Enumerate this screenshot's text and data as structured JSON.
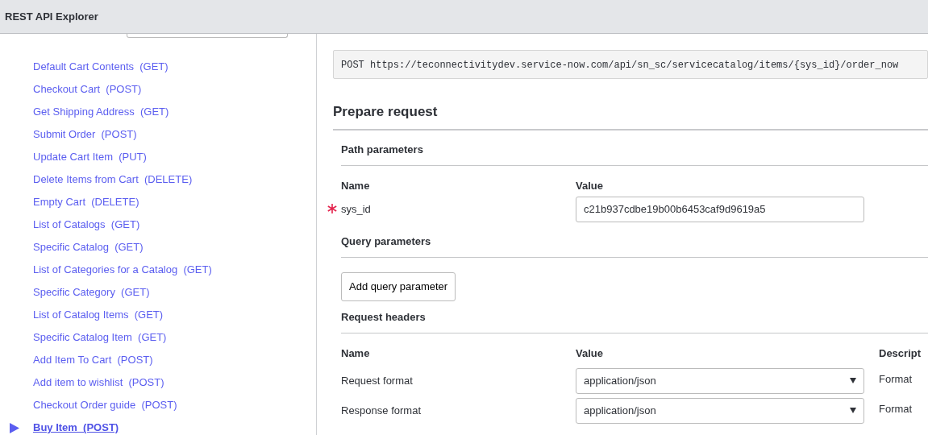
{
  "window": {
    "title": "REST API Explorer"
  },
  "sidebar": {
    "items": [
      {
        "label": "Default Cart Contents",
        "method": "(GET)",
        "selected": false
      },
      {
        "label": "Checkout Cart",
        "method": "(POST)",
        "selected": false
      },
      {
        "label": "Get Shipping Address",
        "method": "(GET)",
        "selected": false
      },
      {
        "label": "Submit Order",
        "method": "(POST)",
        "selected": false
      },
      {
        "label": "Update Cart Item",
        "method": "(PUT)",
        "selected": false
      },
      {
        "label": "Delete Items from Cart",
        "method": "(DELETE)",
        "selected": false
      },
      {
        "label": "Empty Cart",
        "method": "(DELETE)",
        "selected": false
      },
      {
        "label": "List of Catalogs",
        "method": "(GET)",
        "selected": false
      },
      {
        "label": "Specific Catalog",
        "method": "(GET)",
        "selected": false
      },
      {
        "label": "List of Categories for a Catalog",
        "method": "(GET)",
        "selected": false
      },
      {
        "label": "Specific Category",
        "method": "(GET)",
        "selected": false
      },
      {
        "label": "List of Catalog Items",
        "method": "(GET)",
        "selected": false
      },
      {
        "label": "Specific Catalog Item",
        "method": "(GET)",
        "selected": false
      },
      {
        "label": "Add Item To Cart",
        "method": "(POST)",
        "selected": false
      },
      {
        "label": "Add item to wishlist",
        "method": "(POST)",
        "selected": false
      },
      {
        "label": "Checkout Order guide",
        "method": "(POST)",
        "selected": false
      },
      {
        "label": "Buy Item",
        "method": "(POST)",
        "selected": true
      }
    ]
  },
  "endpoint": "POST https://teconnectivitydev.service-now.com/api/sn_sc/servicecatalog/items/{sys_id}/order_now",
  "prepare_request": {
    "title": "Prepare request",
    "path_parameters": {
      "title": "Path parameters",
      "columns": [
        "Name",
        "Value"
      ],
      "rows": [
        {
          "name": "sys_id",
          "required": true,
          "value": "c21b937cdbe19b00b6453caf9d9619a5"
        }
      ]
    },
    "query_parameters": {
      "title": "Query parameters",
      "add_button": "Add query parameter"
    },
    "request_headers": {
      "title": "Request headers",
      "columns": [
        "Name",
        "Value",
        "Descript"
      ],
      "rows": [
        {
          "name": "Request format",
          "value": "application/json",
          "description": "Format"
        },
        {
          "name": "Response format",
          "value": "application/json",
          "description": "Format"
        }
      ]
    }
  }
}
